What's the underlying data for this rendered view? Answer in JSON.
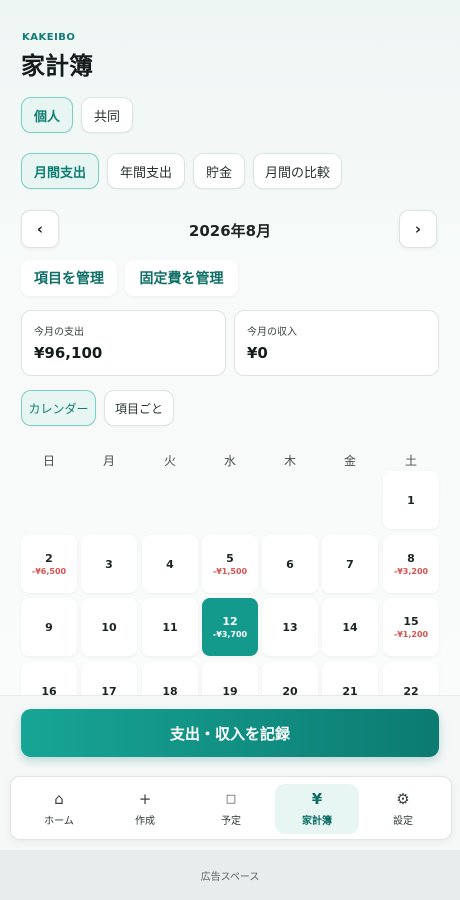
{
  "header": {
    "brand": "KAKEIBO",
    "title": "家計簿"
  },
  "scope_tabs": [
    {
      "label": "個人",
      "active": true
    },
    {
      "label": "共同",
      "active": false
    }
  ],
  "view_tabs": [
    {
      "label": "月間支出",
      "active": true
    },
    {
      "label": "年間支出",
      "active": false
    },
    {
      "label": "貯金",
      "active": false
    },
    {
      "label": "月間の比較",
      "active": false
    }
  ],
  "month_nav": {
    "prev_icon": "‹",
    "label": "2026年8月",
    "next_icon": "›"
  },
  "manage": {
    "items_label": "項目を管理",
    "fixed_label": "固定費を管理"
  },
  "stats": {
    "expense": {
      "label": "今月の支出",
      "value": "¥96,100"
    },
    "income": {
      "label": "今月の収入",
      "value": "¥0"
    }
  },
  "mode_tabs": [
    {
      "label": "カレンダー",
      "active": true
    },
    {
      "label": "項目ごと",
      "active": false
    }
  ],
  "weekdays": [
    "日",
    "月",
    "火",
    "水",
    "木",
    "金",
    "土"
  ],
  "calendar_days": [
    {
      "day": "1",
      "amount": ""
    },
    {
      "day": "2",
      "amount": "-¥6,500"
    },
    {
      "day": "3",
      "amount": ""
    },
    {
      "day": "4",
      "amount": ""
    },
    {
      "day": "5",
      "amount": "-¥1,500"
    },
    {
      "day": "6",
      "amount": ""
    },
    {
      "day": "7",
      "amount": ""
    },
    {
      "day": "8",
      "amount": "-¥3,200"
    },
    {
      "day": "9",
      "amount": ""
    },
    {
      "day": "10",
      "amount": ""
    },
    {
      "day": "11",
      "amount": ""
    },
    {
      "day": "12",
      "amount": "-¥3,700",
      "selected": true
    },
    {
      "day": "13",
      "amount": ""
    },
    {
      "day": "14",
      "amount": ""
    },
    {
      "day": "15",
      "amount": "-¥1,200"
    },
    {
      "day": "16",
      "amount": ""
    },
    {
      "day": "17",
      "amount": ""
    },
    {
      "day": "18",
      "amount": ""
    },
    {
      "day": "19",
      "amount": ""
    },
    {
      "day": "20",
      "amount": ""
    },
    {
      "day": "21",
      "amount": ""
    },
    {
      "day": "22",
      "amount": ""
    }
  ],
  "record_button": "支出・収入を記録",
  "tabbar": [
    {
      "icon": "home-icon",
      "glyph": "⌂",
      "label": "ホーム",
      "active": false
    },
    {
      "icon": "plus-icon",
      "glyph": "+",
      "label": "作成",
      "active": false
    },
    {
      "icon": "square-icon",
      "glyph": "□",
      "label": "予定",
      "active": false
    },
    {
      "icon": "yen-icon",
      "glyph": "¥",
      "label": "家計簿",
      "active": true
    },
    {
      "icon": "gear-icon",
      "glyph": "⚙",
      "label": "設定",
      "active": false
    }
  ],
  "ad_label": "広告スペース",
  "colors": {
    "accent": "#14998d",
    "negative": "#d9534f"
  }
}
